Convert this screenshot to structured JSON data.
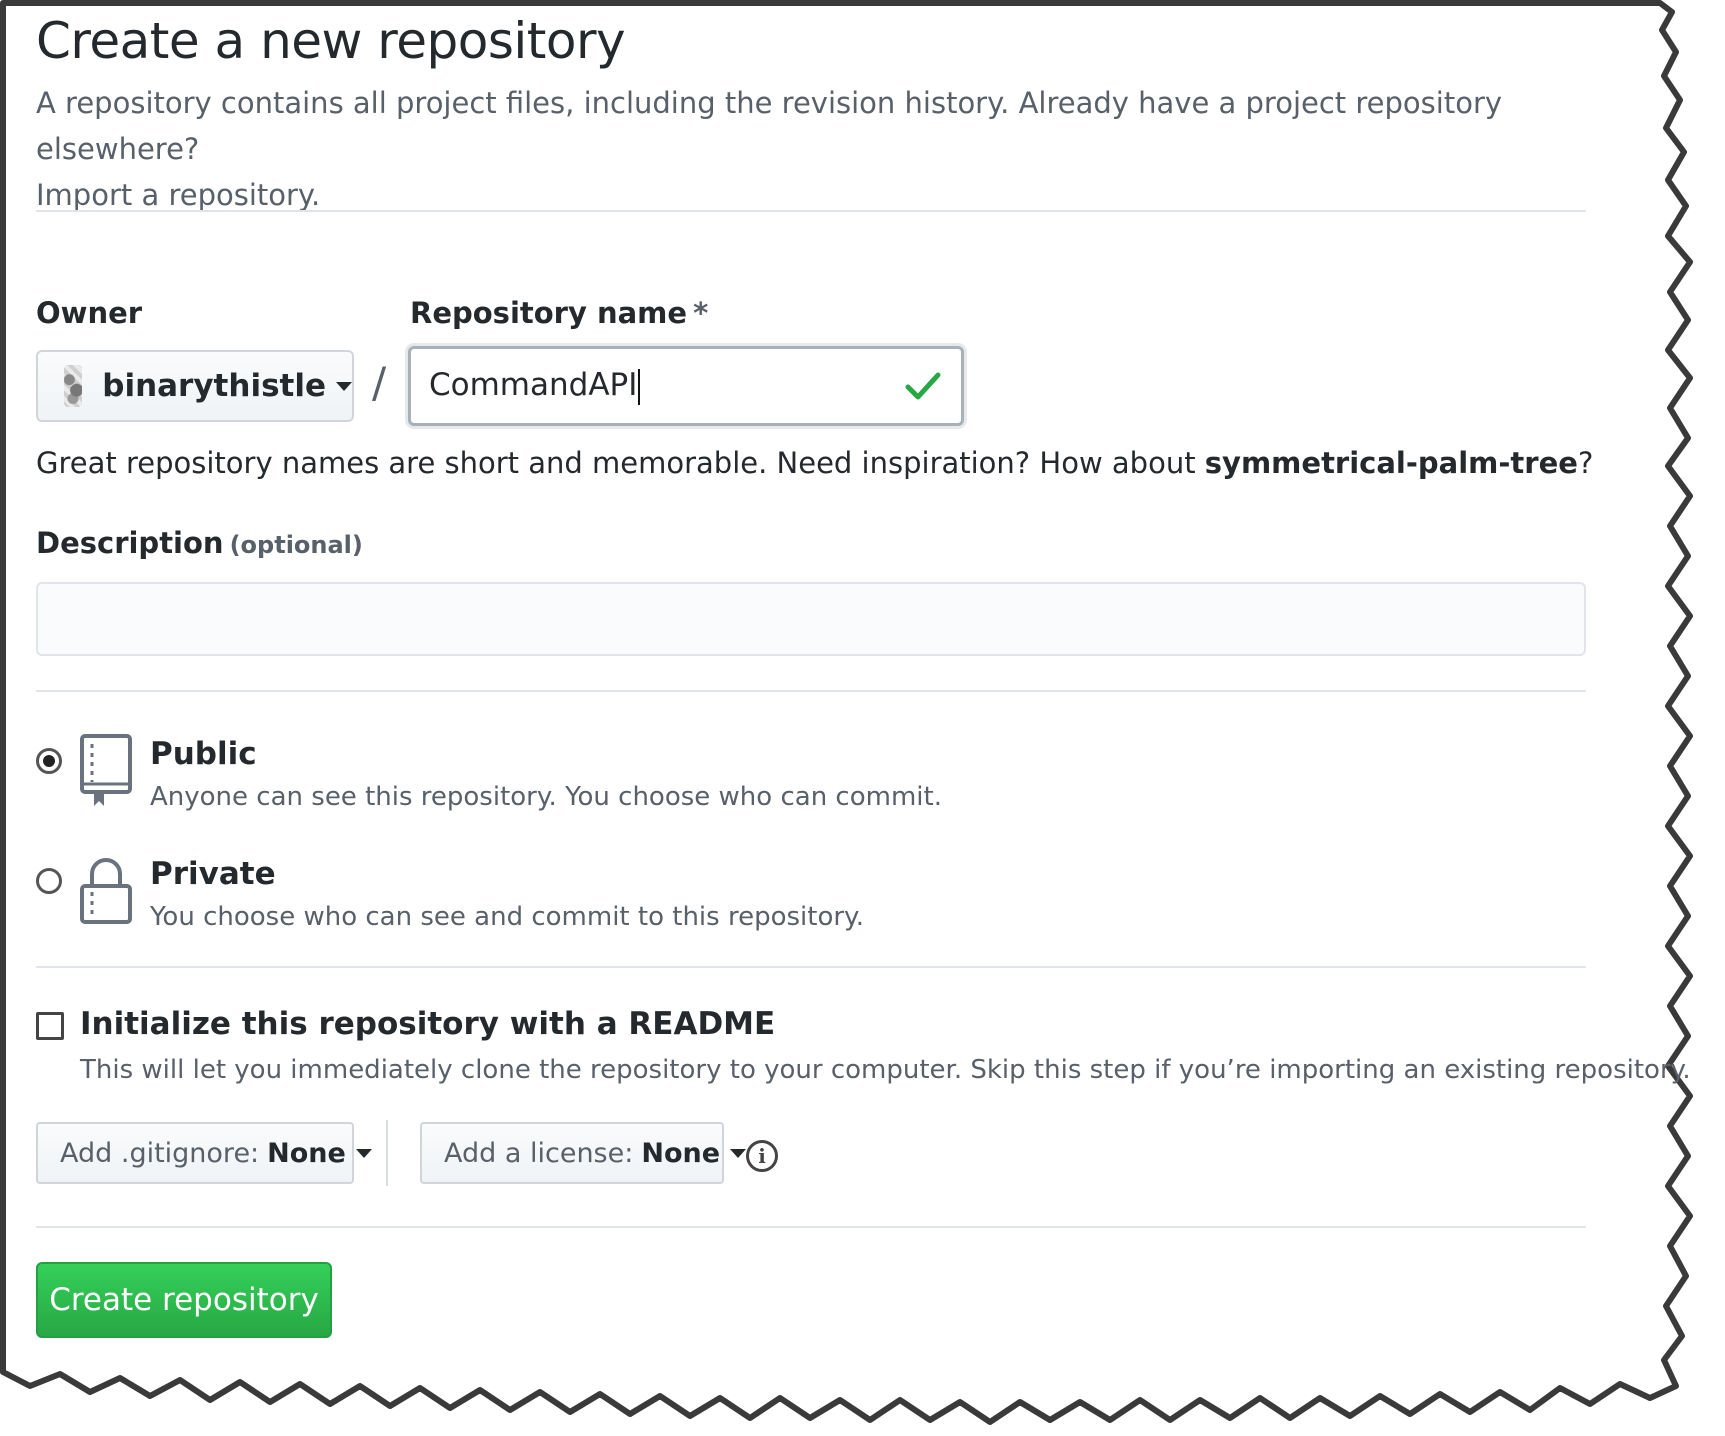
{
  "header": {
    "title": "Create a new repository",
    "intro": "A repository contains all project files, including the revision history. Already have a project repository elsewhere?",
    "import_link": "Import a repository."
  },
  "owner": {
    "label": "Owner",
    "value": "binarythistle"
  },
  "slash": "/",
  "repo_name": {
    "label": "Repository name",
    "required_marker": "*",
    "value": "CommandAPI"
  },
  "hint": {
    "text": "Great repository names are short and memorable. Need inspiration? How about ",
    "suggestion": "symmetrical-palm-tree",
    "suffix": "?"
  },
  "description": {
    "label": "Description",
    "optional": "(optional)",
    "value": ""
  },
  "visibility": {
    "public": {
      "title": "Public",
      "desc": "Anyone can see this repository. You choose who can commit.",
      "selected": true
    },
    "private": {
      "title": "Private",
      "desc": "You choose who can see and commit to this repository.",
      "selected": false
    }
  },
  "init": {
    "title": "Initialize this repository with a README",
    "desc": "This will let you immediately clone the repository to your computer. Skip this step if you’re importing an existing repository.",
    "checked": false
  },
  "gitignore": {
    "label": "Add .gitignore:",
    "value": "None"
  },
  "license": {
    "label": "Add a license:",
    "value": "None"
  },
  "submit": {
    "label": "Create repository"
  },
  "colors": {
    "primary_button": "#2ea44f",
    "success_check": "#28a745",
    "text": "#24292e",
    "muted_text": "#586069",
    "border": "#e1e4e8"
  }
}
